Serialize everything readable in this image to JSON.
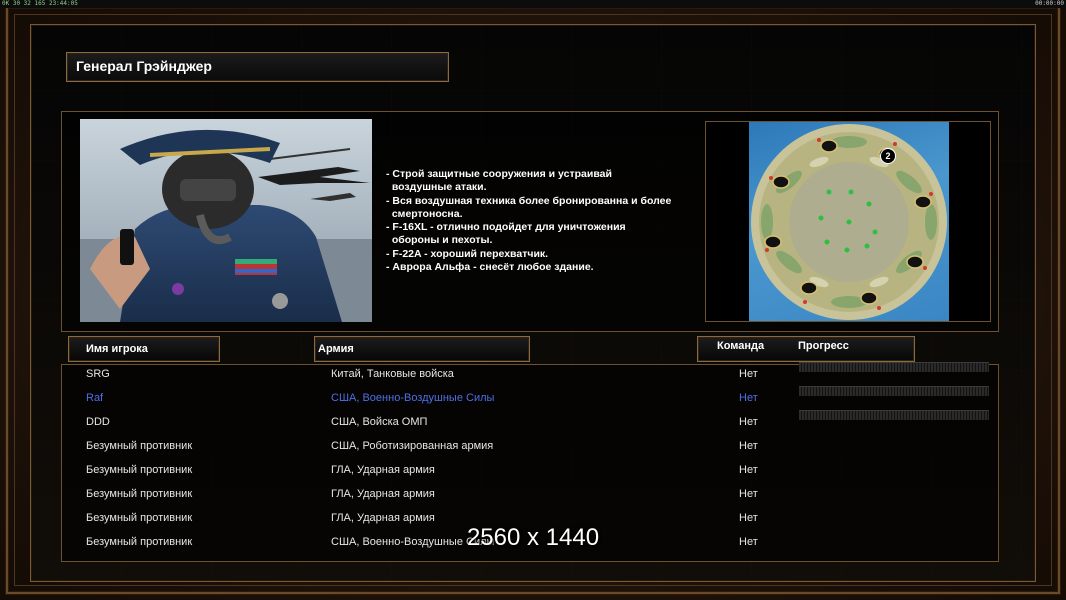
{
  "status_bar": {
    "left": "0K 30 32 165 23:44:05",
    "right": "00:00:00"
  },
  "general": {
    "name": "Генерал Грэйнджер",
    "bullets": [
      "- Строй защитные сооружения и устраивай",
      "  воздушные атаки.",
      "- Вся воздушная техника более бронированна и более",
      "  смертоносна.",
      "- F-16XL - отлично подойдет для уничтожения",
      "  обороны и пехоты.",
      "- F-22A - хороший перехватчик.",
      "- Аврора Альфа - снесёт любое здание."
    ]
  },
  "map": {
    "player_marker": "2"
  },
  "table": {
    "headers": {
      "player": "Имя игрока",
      "army": "Армия",
      "team": "Команда",
      "progress": "Прогресс"
    },
    "rows": [
      {
        "player": "SRG",
        "army": "Китай, Танковые войска",
        "team": "Нет",
        "has_progress": true,
        "active": false
      },
      {
        "player": "Raf",
        "army": "США, Военно-Воздушные Силы",
        "team": "Нет",
        "has_progress": true,
        "active": true
      },
      {
        "player": "DDD",
        "army": "США, Войска ОМП",
        "team": "Нет",
        "has_progress": true,
        "active": false
      },
      {
        "player": "Безумный противник",
        "army": "США, Роботизированная армия",
        "team": "Нет",
        "has_progress": false,
        "active": false
      },
      {
        "player": "Безумный противник",
        "army": "ГЛА, Ударная армия",
        "team": "Нет",
        "has_progress": false,
        "active": false
      },
      {
        "player": "Безумный противник",
        "army": "ГЛА, Ударная армия",
        "team": "Нет",
        "has_progress": false,
        "active": false
      },
      {
        "player": "Безумный противник",
        "army": "ГЛА, Ударная армия",
        "team": "Нет",
        "has_progress": false,
        "active": false
      },
      {
        "player": "Безумный противник",
        "army": "США, Военно-Воздушные Силы",
        "team": "Нет",
        "has_progress": false,
        "active": false
      }
    ]
  },
  "overlay": {
    "resolution": "2560 x 1440"
  },
  "colors": {
    "frame_border": "#8a6a40",
    "active_player": "#4e6fe8",
    "panel_bg": "#050505"
  }
}
